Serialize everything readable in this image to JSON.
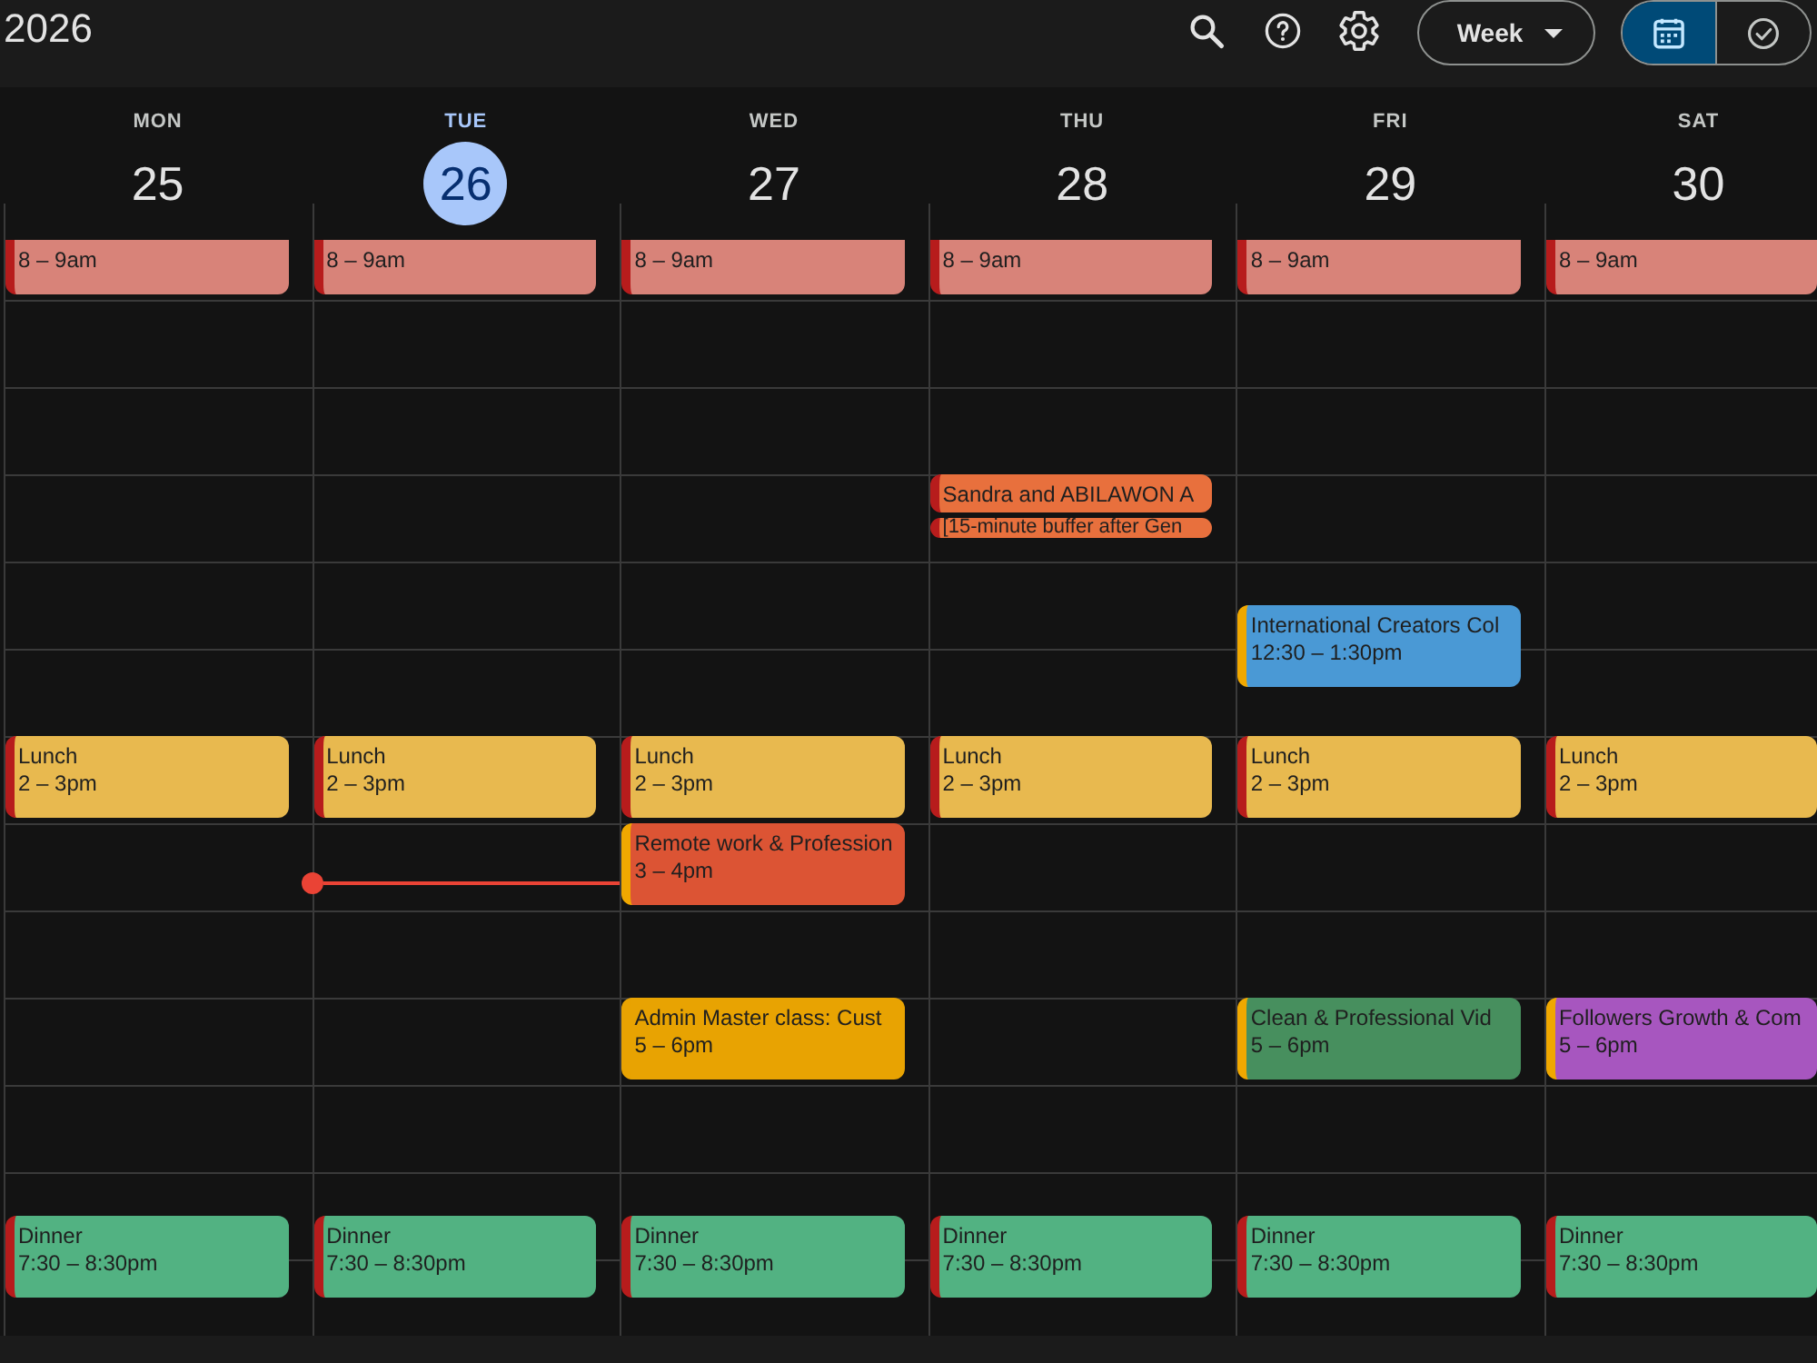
{
  "top_bar": {
    "title": "2026",
    "view_menu": {
      "label": "Week"
    },
    "view_toggle": [
      {
        "kind": "calendar",
        "selected": true
      },
      {
        "kind": "tasks",
        "selected": false
      }
    ]
  },
  "days": [
    {
      "weekday": "MON",
      "date": "25",
      "today": false,
      "events": [
        {
          "time": "8 – 9am",
          "color": "#d88379",
          "stripe": {
            "color": "#b71c1c"
          }
        },
        {
          "title": "Lunch",
          "time": "2 – 3pm",
          "color": "#e8b94f",
          "stripe": {
            "color": "#b71c1c"
          }
        },
        {
          "title": "Dinner",
          "time": "7:30 – 8:30pm",
          "color": "#52b282",
          "stripe": {
            "color": "#b71c1c"
          }
        }
      ]
    },
    {
      "weekday": "TUE",
      "date": "26",
      "today": true,
      "events": [
        {
          "time": "8 – 9am",
          "color": "#d88379",
          "stripe": {
            "color": "#b71c1c"
          }
        },
        {
          "title": "Lunch",
          "time": "2 – 3pm",
          "color": "#e8b94f",
          "stripe": {
            "color": "#b71c1c"
          }
        },
        {
          "title": "Dinner",
          "time": "7:30 – 8:30pm",
          "color": "#52b282",
          "stripe": {
            "color": "#b71c1c"
          }
        }
      ]
    },
    {
      "weekday": "WED",
      "date": "27",
      "today": false,
      "events": [
        {
          "time": "8 – 9am",
          "color": "#d88379",
          "stripe": {
            "color": "#b71c1c"
          }
        },
        {
          "title": "Lunch",
          "time": "2 – 3pm",
          "color": "#e8b94f",
          "stripe": {
            "color": "#b71c1c"
          }
        },
        {
          "title": "Remote work & Profession",
          "time": "3 – 4pm",
          "color": "#dc5434",
          "stripe": {
            "color": "#f0a800"
          }
        },
        {
          "title": "Admin Master class: Cust",
          "time": "5 – 6pm",
          "color": "#e8a302",
          "stripe": {
            "color": "#e8a302"
          }
        },
        {
          "title": "Dinner",
          "time": "7:30 – 8:30pm",
          "color": "#52b282",
          "stripe": {
            "color": "#b71c1c"
          }
        }
      ]
    },
    {
      "weekday": "THU",
      "date": "28",
      "today": false,
      "events": [
        {
          "time": "8 – 9am",
          "color": "#d88379",
          "stripe": {
            "color": "#b71c1c"
          }
        },
        {
          "title": "Sandra and ABILAWON A",
          "color": "#e8703d",
          "stripe": {
            "color": "#b71c1c"
          }
        },
        {
          "title": "[15-minute buffer after Gen",
          "color": "#e8703d",
          "stripe": {
            "color": "#b71c1c"
          }
        },
        {
          "title": "Lunch",
          "time": "2 – 3pm",
          "color": "#e8b94f",
          "stripe": {
            "color": "#b71c1c"
          }
        },
        {
          "title": "Dinner",
          "time": "7:30 – 8:30pm",
          "color": "#52b282",
          "stripe": {
            "color": "#b71c1c"
          }
        }
      ]
    },
    {
      "weekday": "FRI",
      "date": "29",
      "today": false,
      "events": [
        {
          "time": "8 – 9am",
          "color": "#d88379",
          "stripe": {
            "color": "#b71c1c"
          }
        },
        {
          "title": "International Creators Col",
          "time": "12:30 – 1:30pm",
          "color": "#4a99d5",
          "stripe": {
            "color": "#f0a800"
          }
        },
        {
          "title": "Lunch",
          "time": "2 – 3pm",
          "color": "#e8b94f",
          "stripe": {
            "color": "#b71c1c"
          }
        },
        {
          "title": "Clean & Professional Vid",
          "time": "5 – 6pm",
          "color": "#478f5e",
          "stripe": {
            "color": "#f0a800"
          }
        },
        {
          "title": "Dinner",
          "time": "7:30 – 8:30pm",
          "color": "#52b282",
          "stripe": {
            "color": "#b71c1c"
          }
        }
      ]
    },
    {
      "weekday": "SAT",
      "date": "30",
      "today": false,
      "events": [
        {
          "time": "8 – 9am",
          "color": "#d88379",
          "stripe": {
            "color": "#b71c1c"
          }
        },
        {
          "title": "Lunch",
          "time": "2 – 3pm",
          "color": "#e8b94f",
          "stripe": {
            "color": "#b71c1c"
          }
        },
        {
          "title": "Followers Growth & Com",
          "time": "5 – 6pm",
          "color": "#a756bf",
          "stripe": {
            "color": "#f0a800"
          }
        },
        {
          "title": "Dinner",
          "time": "7:30 – 8:30pm",
          "color": "#52b282",
          "stripe": {
            "color": "#b71c1c"
          }
        }
      ]
    }
  ]
}
